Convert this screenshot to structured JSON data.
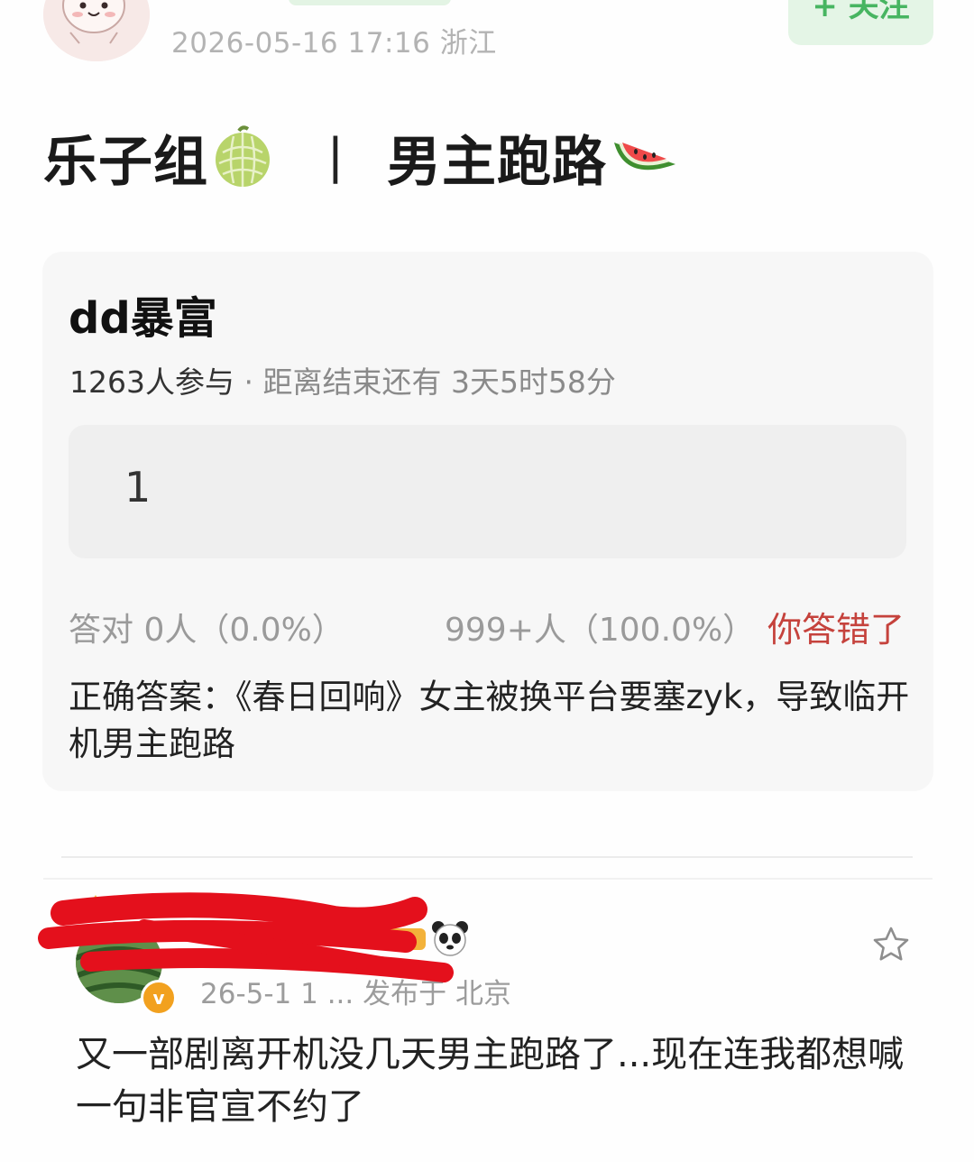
{
  "post": {
    "meta": "2026-05-16 17:16  浙江",
    "follow_label": "+ 关注",
    "title_left": "乐子组",
    "title_sep": "丨",
    "title_right": "男主跑路",
    "title_icons": [
      "melon-emoji",
      "watermelon-emoji"
    ]
  },
  "quiz": {
    "title": "dd暴富",
    "participants": "1263人参与",
    "countdown": " · 距离结束还有 3天5时58分",
    "answer": "1",
    "correct_stat": "答对  0人（0.0%）",
    "wrong_stat": "999+人（100.0%）",
    "result": "你答错了",
    "correct_answer": "正确答案：《春日回响》女主被换平台要塞zyk，导致临开机男主跑路",
    "colors": {
      "result": "#c5423c",
      "follow": "#47b561"
    }
  },
  "comment": {
    "meta": "26-5-1 1 ... 发布于 北京",
    "text": "又一部剧离开机没几天男主跑路了...现在连我都想喊一句非官宣不约了",
    "icons": [
      "crown-icon",
      "vip-badge-icon",
      "level-badge-icon",
      "panda-emoji",
      "star-icon"
    ],
    "vip_glyph": "v"
  }
}
